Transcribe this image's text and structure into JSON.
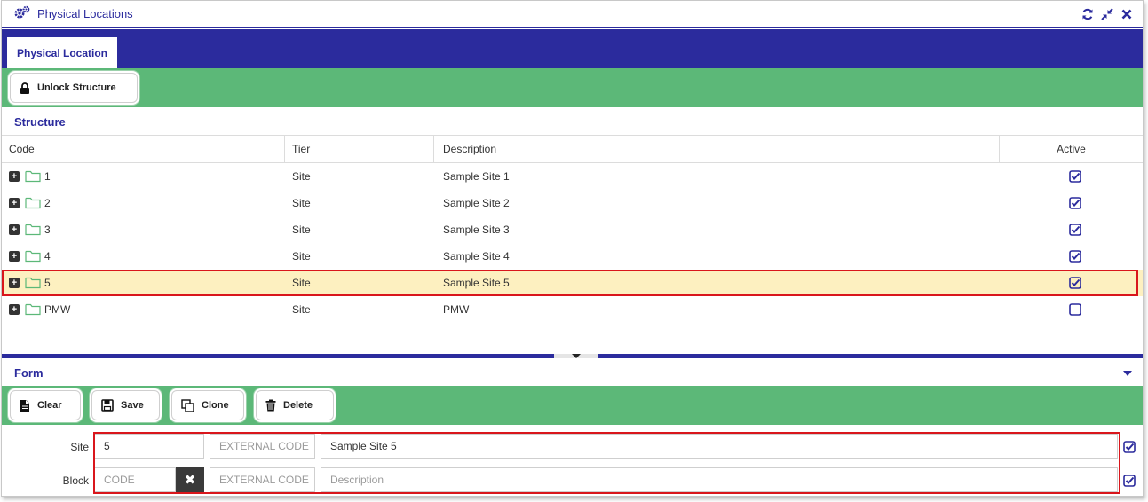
{
  "window": {
    "title": "Physical Locations",
    "title_icon": "gears-icon",
    "tools": [
      "refresh-icon",
      "collapse-icon",
      "close-icon"
    ]
  },
  "tabs": [
    {
      "label": "Physical Location",
      "active": true
    }
  ],
  "toolbar": {
    "unlock_label": "Unlock Structure"
  },
  "structure": {
    "title": "Structure",
    "columns": [
      "Code",
      "Tier",
      "Description",
      "Active"
    ],
    "rows": [
      {
        "code": "1",
        "tier": "Site",
        "description": "Sample Site 1",
        "active": true,
        "selected": false
      },
      {
        "code": "2",
        "tier": "Site",
        "description": "Sample Site 2",
        "active": true,
        "selected": false
      },
      {
        "code": "3",
        "tier": "Site",
        "description": "Sample Site 3",
        "active": true,
        "selected": false
      },
      {
        "code": "4",
        "tier": "Site",
        "description": "Sample Site 4",
        "active": true,
        "selected": false
      },
      {
        "code": "5",
        "tier": "Site",
        "description": "Sample Site 5",
        "active": true,
        "selected": true
      },
      {
        "code": "PMW",
        "tier": "Site",
        "description": "PMW",
        "active": false,
        "selected": false
      }
    ]
  },
  "form": {
    "title": "Form",
    "buttons": {
      "clear": "Clear",
      "save": "Save",
      "clone": "Clone",
      "delete": "Delete"
    },
    "site": {
      "label": "Site",
      "code_value": "5",
      "external_placeholder": "EXTERNAL CODE",
      "description_value": "Sample Site 5",
      "active": true
    },
    "block": {
      "label": "Block",
      "code_placeholder": "CODE",
      "external_placeholder": "EXTERNAL CODE",
      "description_placeholder": "Description",
      "active": true
    }
  },
  "colors": {
    "primary": "#2b2b9d",
    "toolbar_green": "#5cb878",
    "selected_row": "#fdf0c0",
    "highlight_outline": "#d9161c"
  }
}
